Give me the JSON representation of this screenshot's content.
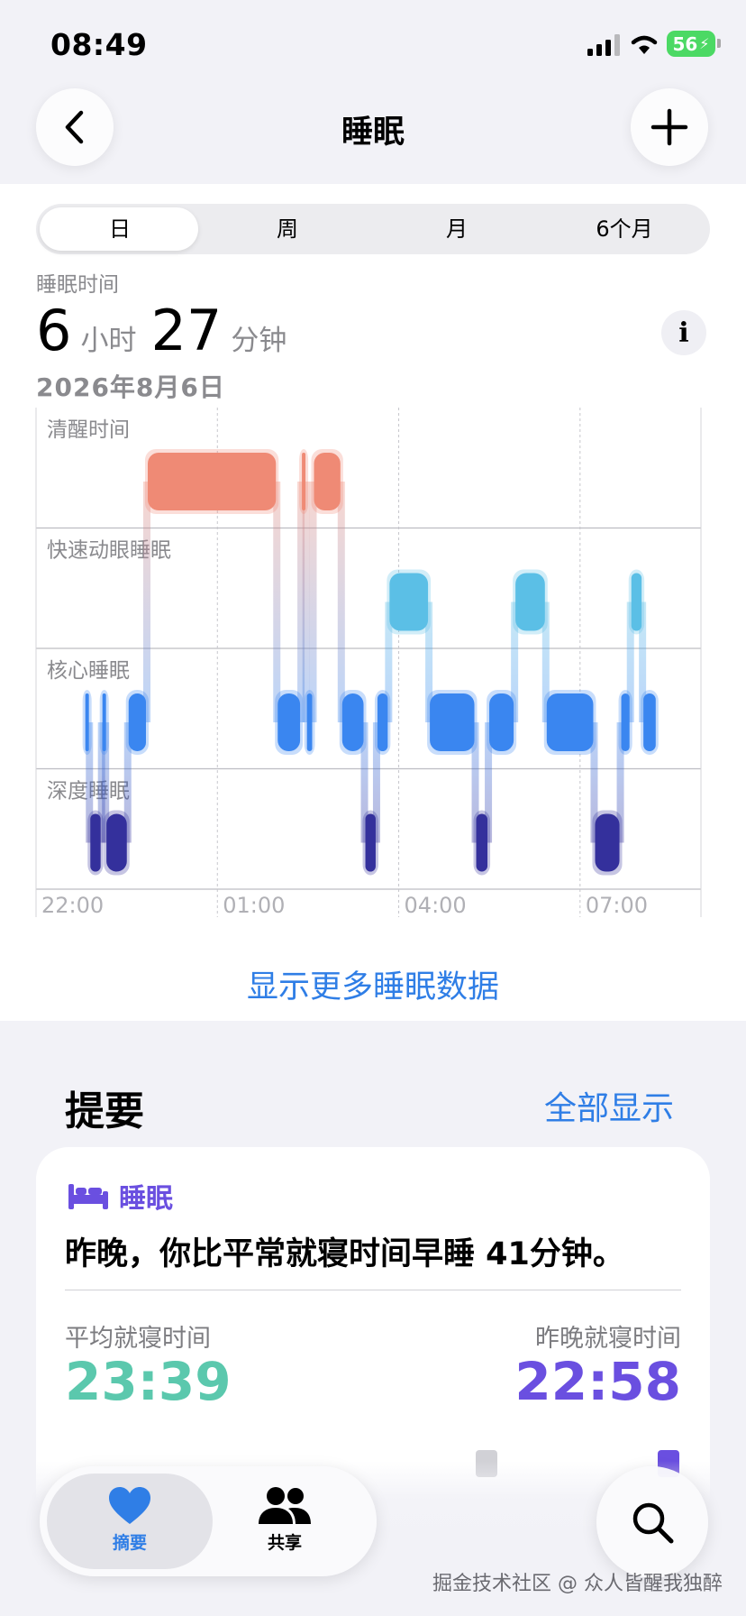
{
  "status_bar": {
    "time": "08:49",
    "battery": "56"
  },
  "header": {
    "title": "睡眠"
  },
  "segments": [
    "日",
    "周",
    "月",
    "6个月"
  ],
  "selected_segment": "日",
  "summary_stat": {
    "label": "睡眠时间",
    "hours": "6",
    "hours_unit": "小时",
    "minutes": "27",
    "minutes_unit": "分钟",
    "date": "2026年8月6日"
  },
  "chart_data": {
    "type": "sleep-stage-timeline",
    "stages": [
      "清醒时间",
      "快速动眼睡眠",
      "核心睡眠",
      "深度睡眠"
    ],
    "x_ticks": [
      "22:00",
      "01:00",
      "04:00",
      "07:00"
    ],
    "colors": {
      "清醒时间": "#ef8a75",
      "快速动眼睡眠": "#5bbfe6",
      "核心睡眠": "#3a86f0",
      "深度睡眠": "#34309c"
    },
    "segments": [
      {
        "stage": "核心睡眠",
        "start": "22:48",
        "end": "22:53"
      },
      {
        "stage": "深度睡眠",
        "start": "22:53",
        "end": "23:05"
      },
      {
        "stage": "核心睡眠",
        "start": "23:05",
        "end": "23:09"
      },
      {
        "stage": "深度睡眠",
        "start": "23:09",
        "end": "23:31"
      },
      {
        "stage": "核心睡眠",
        "start": "23:31",
        "end": "23:50"
      },
      {
        "stage": "清醒时间",
        "start": "23:50",
        "end": "01:59"
      },
      {
        "stage": "核心睡眠",
        "start": "01:59",
        "end": "02:23"
      },
      {
        "stage": "清醒时间",
        "start": "02:23",
        "end": "02:28"
      },
      {
        "stage": "核心睡眠",
        "start": "02:28",
        "end": "02:35"
      },
      {
        "stage": "清醒时间",
        "start": "02:35",
        "end": "03:03"
      },
      {
        "stage": "核心睡眠",
        "start": "03:03",
        "end": "03:26"
      },
      {
        "stage": "深度睡眠",
        "start": "03:26",
        "end": "03:38"
      },
      {
        "stage": "核心睡眠",
        "start": "03:38",
        "end": "03:50"
      },
      {
        "stage": "快速动眼睡眠",
        "start": "03:50",
        "end": "04:30"
      },
      {
        "stage": "核心睡眠",
        "start": "04:30",
        "end": "05:16"
      },
      {
        "stage": "深度睡眠",
        "start": "05:16",
        "end": "05:29"
      },
      {
        "stage": "核心睡眠",
        "start": "05:29",
        "end": "05:55"
      },
      {
        "stage": "快速动眼睡眠",
        "start": "05:55",
        "end": "06:26"
      },
      {
        "stage": "核心睡眠",
        "start": "06:26",
        "end": "07:14"
      },
      {
        "stage": "深度睡眠",
        "start": "07:14",
        "end": "07:40"
      },
      {
        "stage": "核心睡眠",
        "start": "07:40",
        "end": "07:50"
      },
      {
        "stage": "快速动眼睡眠",
        "start": "07:50",
        "end": "08:02"
      },
      {
        "stage": "核心睡眠",
        "start": "08:02",
        "end": "08:16"
      }
    ]
  },
  "more_link": "显示更多睡眠数据",
  "summary": {
    "title": "提要",
    "show_all": "全部显示",
    "card": {
      "category": "睡眠",
      "text": "昨晚，你比平常就寝时间早睡 41分钟。",
      "avg_label": "平均就寝时间",
      "avg_value": "23:39",
      "last_label": "昨晚就寝时间",
      "last_value": "22:58"
    }
  },
  "tabbar": {
    "summary": "摘要",
    "sharing": "共享"
  },
  "watermark": "掘金技术社区 @ 众人皆醒我独醉",
  "icons": [
    "back-chevron-icon",
    "plus-icon",
    "info-icon",
    "bed-icon",
    "heart-icon",
    "people-icon",
    "search-icon",
    "signal-icon",
    "wifi-icon",
    "battery-icon"
  ]
}
